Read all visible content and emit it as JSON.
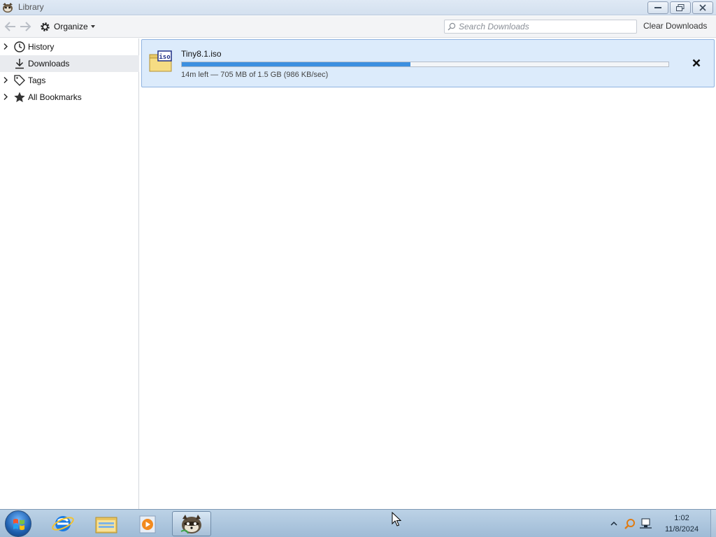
{
  "window": {
    "title": "Library"
  },
  "toolbar": {
    "organize_label": "Organize",
    "search_placeholder": "Search Downloads",
    "search_value": "",
    "clear_label": "Clear Downloads"
  },
  "sidebar": {
    "items": [
      {
        "label": "History",
        "icon": "clock-icon",
        "expandable": true,
        "selected": false
      },
      {
        "label": "Downloads",
        "icon": "download-arrow-icon",
        "expandable": false,
        "selected": true
      },
      {
        "label": "Tags",
        "icon": "tag-icon",
        "expandable": true,
        "selected": false
      },
      {
        "label": "All Bookmarks",
        "icon": "star-icon",
        "expandable": true,
        "selected": false
      }
    ]
  },
  "downloads": [
    {
      "file_name": "Tiny8.1.iso",
      "file_icon_text": "iso",
      "status": "14m left — 705 MB of 1.5 GB (986 KB/sec)",
      "progress_percent": 47
    }
  ],
  "taskbar": {
    "apps": [
      "start-orb-icon",
      "internet-explorer-icon",
      "file-explorer-icon",
      "media-player-icon",
      "firefox-library-icon"
    ],
    "clock_time": "1:02",
    "clock_date": "11/8/2024"
  },
  "colors": {
    "selection_bg": "#e9ebef",
    "download_row_bg": "#dcebfb",
    "progress_fill": "#3c8fe0",
    "taskbar_bg": "#bcd2e6"
  }
}
